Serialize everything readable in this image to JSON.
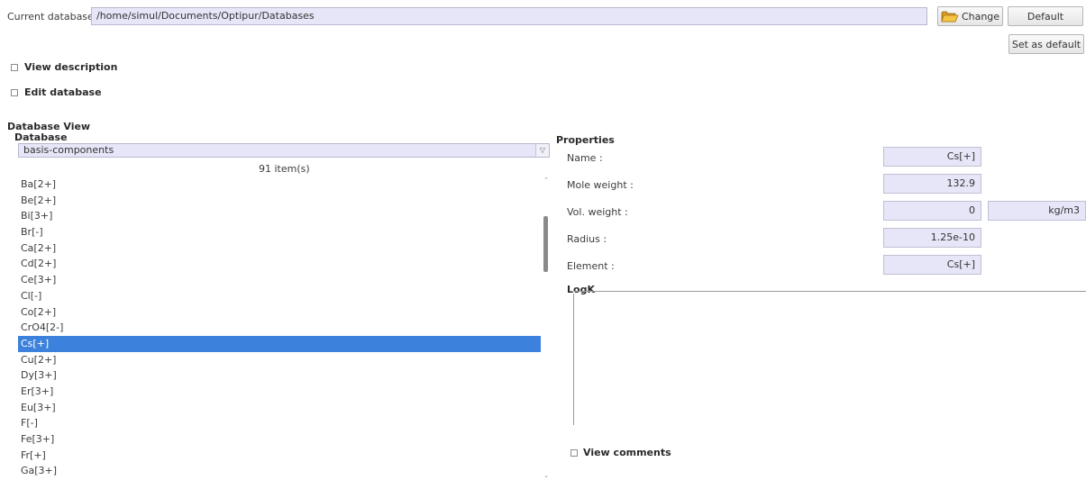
{
  "top": {
    "current_db_label": "Current database",
    "current_db_path": "/home/simul/Documents/Optipur/Databases",
    "change_label": "Change",
    "default_label": "Default",
    "set_default_label": "Set as default",
    "view_description_label": "View description",
    "edit_database_label": "Edit database"
  },
  "db_view": {
    "section_title": "Database View",
    "group_label": "Database",
    "selected_db": "basis-components",
    "item_count": "91 item(s)",
    "items": [
      "Ba[2+]",
      "Be[2+]",
      "Bi[3+]",
      "Br[-]",
      "Ca[2+]",
      "Cd[2+]",
      "Ce[3+]",
      "Cl[-]",
      "Co[2+]",
      "CrO4[2-]",
      "Cs[+]",
      "Cu[2+]",
      "Dy[3+]",
      "Er[3+]",
      "Eu[3+]",
      "F[-]",
      "Fe[3+]",
      "Fr[+]",
      "Ga[3+]"
    ],
    "selected_index": 10
  },
  "properties": {
    "title": "Properties",
    "name_label": "Name :",
    "name_value": "Cs[+]",
    "mole_weight_label": "Mole weight :",
    "mole_weight_value": "132.9",
    "vol_weight_label": "Vol. weight :",
    "vol_weight_value": "0",
    "vol_weight_unit": "kg/m3",
    "radius_label": "Radius :",
    "radius_value": "1.25e-10",
    "element_label": "Element :",
    "element_value": "Cs[+]",
    "logk_label": "LogK",
    "view_comments_label": "View comments"
  },
  "icons": {
    "change": "folder-open-icon"
  }
}
